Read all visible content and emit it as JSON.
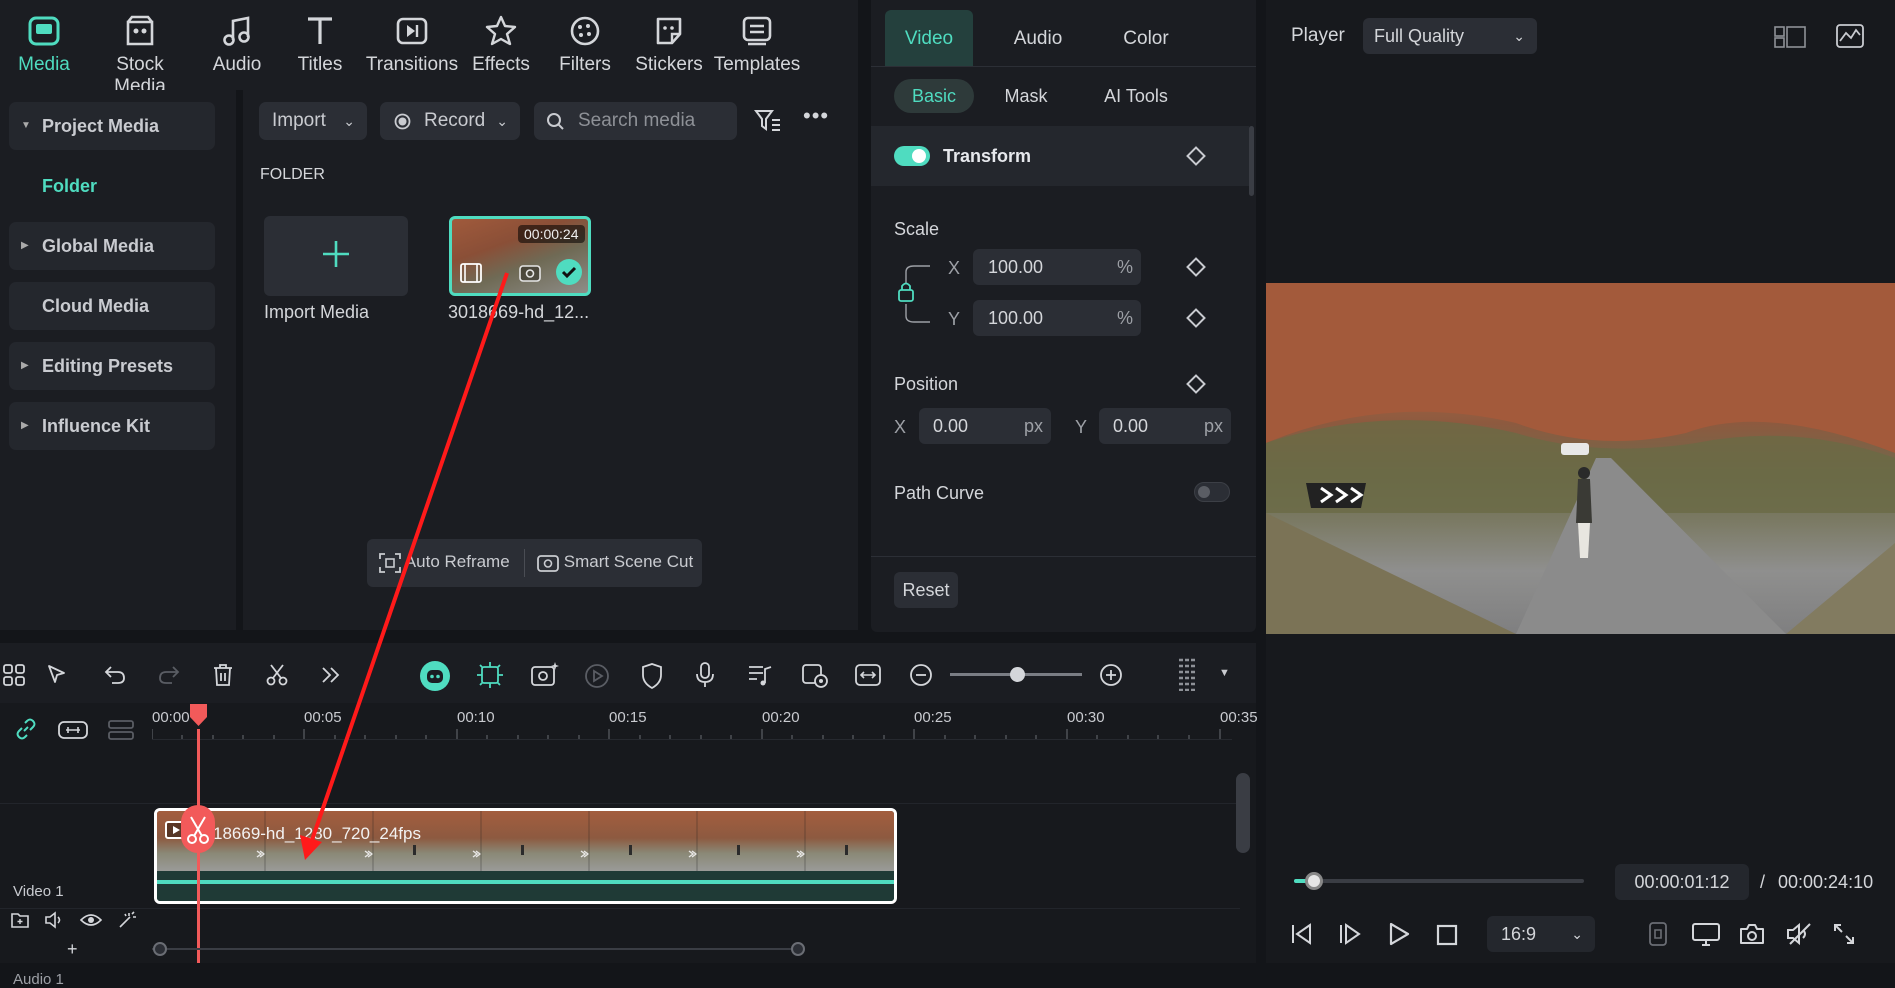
{
  "toolbar": {
    "items": [
      {
        "label": "Media",
        "icon": "media-icon",
        "active": true
      },
      {
        "label": "Stock Media",
        "icon": "stock-media-icon"
      },
      {
        "label": "Audio",
        "icon": "music-note-icon"
      },
      {
        "label": "Titles",
        "icon": "titles-icon"
      },
      {
        "label": "Transitions",
        "icon": "transitions-icon"
      },
      {
        "label": "Effects",
        "icon": "effects-icon"
      },
      {
        "label": "Filters",
        "icon": "filters-icon"
      },
      {
        "label": "Stickers",
        "icon": "stickers-icon"
      },
      {
        "label": "Templates",
        "icon": "templates-icon"
      }
    ]
  },
  "sidebar": {
    "items": [
      {
        "label": "Project Media",
        "expanded": true
      },
      {
        "label": "Folder",
        "active": true
      },
      {
        "label": "Global Media"
      },
      {
        "label": "Cloud Media"
      },
      {
        "label": "Editing Presets"
      },
      {
        "label": "Influence Kit"
      }
    ]
  },
  "media": {
    "import_label": "Import",
    "record_label": "Record",
    "search_placeholder": "Search media",
    "folder_heading": "FOLDER",
    "import_tile_label": "Import Media",
    "clip_duration": "00:00:24",
    "clip_name": "3018669-hd_12...",
    "auto_reframe_label": "Auto Reframe",
    "smart_scene_cut_label": "Smart Scene Cut"
  },
  "properties": {
    "tabs": [
      "Video",
      "Audio",
      "Color"
    ],
    "subtabs": [
      "Basic",
      "Mask",
      "AI Tools"
    ],
    "transform_label": "Transform",
    "scale_label": "Scale",
    "scale_x_axis": "X",
    "scale_x": "100.00",
    "scale_y_axis": "Y",
    "scale_y": "100.00",
    "percent_unit": "%",
    "position_label": "Position",
    "pos_x_axis": "X",
    "pos_x": "0.00",
    "pos_y_axis": "Y",
    "pos_y": "0.00",
    "px_unit": "px",
    "path_curve_label": "Path Curve",
    "reset_label": "Reset"
  },
  "player": {
    "label": "Player",
    "quality": "Full Quality",
    "current_time": "00:00:01:12",
    "separator": "/",
    "total_time": "00:00:24:10",
    "aspect": "16:9",
    "progress": 0.07
  },
  "timeline": {
    "ruler": [
      "00:00",
      "00:05",
      "00:10",
      "00:15",
      "00:20",
      "00:25",
      "00:30",
      "00:35"
    ],
    "clip_label": "18669-hd_1280_720_24fps",
    "video_track_label": "Video 1",
    "audio_track_label": "Audio 1",
    "add_track_symbol": "+"
  },
  "colors": {
    "accent": "#4fdcc0",
    "playhead": "#f25a5a",
    "arrow": "#ff1a1a"
  }
}
